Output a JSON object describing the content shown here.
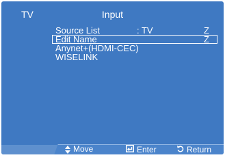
{
  "header": {
    "section_label": "TV",
    "title": "Input"
  },
  "menu": {
    "items": [
      {
        "label": "Source List",
        "value": ": TV",
        "arrow": "Z",
        "selected": false
      },
      {
        "label": "Edit Name",
        "value": "",
        "arrow": "Z",
        "selected": true
      },
      {
        "label": "Anynet+(HDMI-CEC)",
        "value": "",
        "arrow": "",
        "selected": false
      },
      {
        "label": "WISELINK",
        "value": "",
        "arrow": "",
        "selected": false
      }
    ]
  },
  "footer": {
    "move_label": "Move",
    "move_icon": "up-down-icon",
    "enter_label": "Enter",
    "enter_icon": "enter-icon",
    "return_label": "Return",
    "return_icon": "return-icon"
  },
  "colors": {
    "background": "#3f79c2",
    "text": "#ffffff"
  }
}
